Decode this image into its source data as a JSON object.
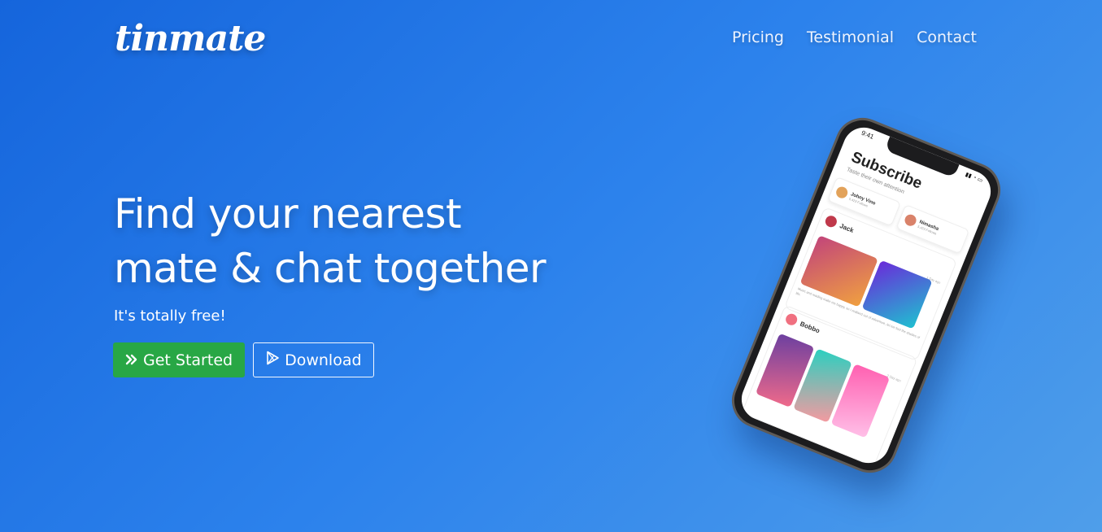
{
  "brand": {
    "logo": "tinmate"
  },
  "nav": {
    "items": [
      "Pricing",
      "Testimonial",
      "Contact"
    ]
  },
  "hero": {
    "headline_line1": "Find your nearest",
    "headline_line2": "mate & chat together",
    "subtitle": "It's totally free!",
    "get_started_label": "Get Started",
    "download_label": "Download"
  },
  "phone": {
    "time": "9:41",
    "title": "Subscribe",
    "subtitle": "Taste their own attention",
    "pills": [
      {
        "name": "Johny Vino",
        "meta": "5,423 Follows"
      },
      {
        "name": "Nimasha",
        "meta": "5,423 Follows"
      }
    ],
    "posts": [
      {
        "name": "Jack",
        "time": "1 Day ago",
        "caption": "Music and reading make me happy, so I realised out of adventure, let me feel the shades of life."
      },
      {
        "name": "Bobbo",
        "time": "2 Day ago"
      }
    ]
  },
  "colors": {
    "accent_green": "#28a745",
    "bg_start": "#1565dc",
    "bg_end": "#4f9eea"
  }
}
